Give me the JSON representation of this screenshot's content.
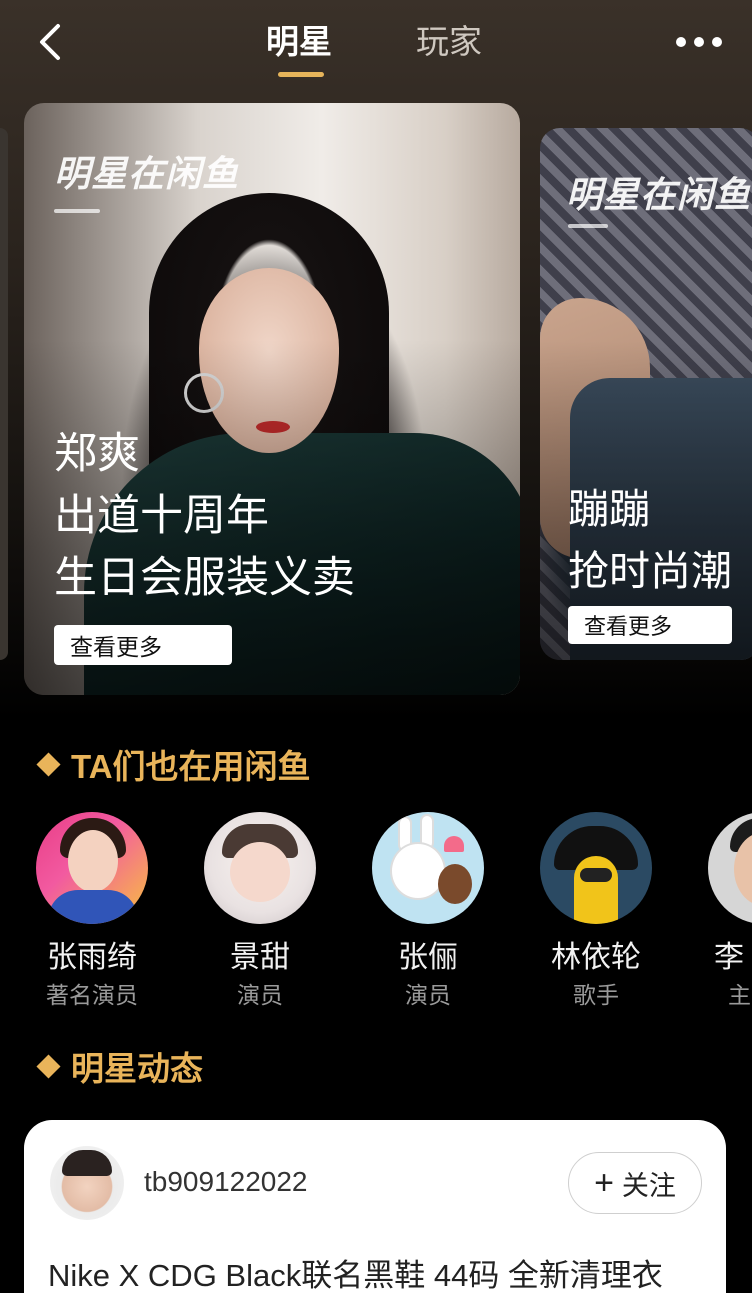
{
  "header": {
    "back_icon": "chevron-left-icon",
    "tabs": [
      {
        "label": "明星",
        "active": true
      },
      {
        "label": "玩家",
        "active": false
      }
    ],
    "more_icon": "more-dots-icon",
    "accent_color": "#e6b45a"
  },
  "banners": [
    {
      "logo": "明星在闲鱼",
      "title_lines": [
        "郑爽",
        "出道十周年",
        "生日会服装义卖"
      ],
      "button_label": "查看更多"
    },
    {
      "logo": "明星在闲鱼",
      "title_lines": [
        "蹦蹦",
        "抢时尚潮"
      ],
      "button_label": "查看更多"
    }
  ],
  "users_section": {
    "heading": "TA们也在用闲鱼",
    "users": [
      {
        "name": "张雨绮",
        "role": "著名演员"
      },
      {
        "name": "景甜",
        "role": "演员"
      },
      {
        "name": "张俪",
        "role": "演员"
      },
      {
        "name": "林依轮",
        "role": "歌手"
      },
      {
        "name": "李",
        "role": "主"
      }
    ]
  },
  "feed_section": {
    "heading": "明星动态",
    "post": {
      "username": "tb909122022",
      "follow_plus": "+",
      "follow_label": "关注",
      "text": "Nike X CDG Black联名黑鞋 44码 全新清理衣"
    }
  }
}
